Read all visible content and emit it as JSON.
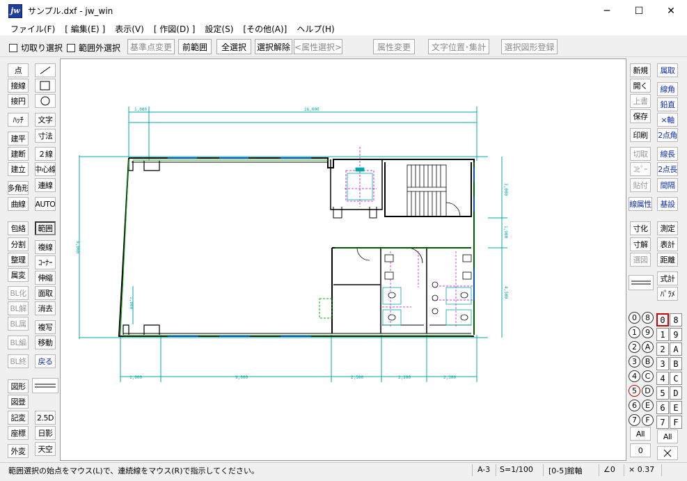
{
  "window": {
    "app_icon_text": "jw",
    "title": "サンプル.dxf - jw_win",
    "minimize": "─",
    "maximize": "☐",
    "close": "✕"
  },
  "menu": [
    "ファイル(F)",
    "[ 編集(E) ]",
    "表示(V)",
    "[ 作図(D) ]",
    "設定(S)",
    "[その他(A)]",
    "ヘルプ(H)"
  ],
  "toolbar": {
    "checkbox_cut_select": "切取り選択",
    "checkbox_outside_select": "範囲外選択",
    "base_point_change": "基準点変更",
    "prev_range": "前範囲",
    "select_all": "全選択",
    "deselect": "選択解除",
    "attr_select": "<属性選択>",
    "attr_change": "属性変更",
    "text_position_total": "文字位置･集計",
    "register_selected_figure": "選択図形登録"
  },
  "left_tools": {
    "point": "点",
    "line_icon": "line-icon",
    "tangent": "接線",
    "rect_icon": "rectangle-icon",
    "tangent_circle": "接円",
    "circle_icon": "circle-icon",
    "hatch": "ﾊｯﾁ",
    "text": "文字",
    "building_plan": "建平",
    "dimension": "寸法",
    "building_section": "建断",
    "double_line": "２線",
    "building_elevation": "建立",
    "center_line": "中心線",
    "polygon": "多角形",
    "continuous_line": "連線",
    "curve": "曲線",
    "auto": "AUTO",
    "envelope": "包絡",
    "range": "範囲",
    "divide": "分割",
    "copy_line": "複線",
    "arrange": "整理",
    "corner": "ｺｰﾅｰ",
    "attr_change": "属変",
    "stretch": "伸縮",
    "bl_make": "BL化",
    "area_fill": "面取",
    "bl_dissolve": "BL解",
    "erase": "消去",
    "bl_attr": "BL属",
    "copy": "複写",
    "bl_edit": "BL編",
    "move": "移動",
    "bl_end": "BL終",
    "back": "戻る",
    "figure": "図形",
    "figure_register": "図登",
    "symbol_change": "記変",
    "view_2_5d": "2.5D",
    "coordinate": "座標",
    "sun_shadow": "日影",
    "external_change": "外変",
    "sky": "天空"
  },
  "right_tools": {
    "new": "新規",
    "attr_get": "属取",
    "open": "開く",
    "line_angle": "線角",
    "overwrite": "上書",
    "vertical": "鉛直",
    "save": "保存",
    "x_axis": "×軸",
    "print": "印刷",
    "two_point_angle": "2点角",
    "cut": "切取",
    "line_length": "線長",
    "copy": "ｺﾋﾟｰ",
    "two_point_length": "2点長",
    "paste": "貼付",
    "spacing": "間隔",
    "line_attr": "線属性",
    "base_set": "基設",
    "dim_make": "寸化",
    "measure": "測定",
    "dim_release": "寸解",
    "table_calc": "表計",
    "select_figure": "選図",
    "distance": "距離",
    "formula": "式計",
    "parametric": "ﾊﾟﾗﾒ"
  },
  "layers": {
    "group_circles": [
      "0",
      "8",
      "1",
      "9",
      "2",
      "A",
      "3",
      "B",
      "4",
      "C",
      "5",
      "D",
      "6",
      "E",
      "7",
      "F"
    ],
    "layer_buttons": [
      "0",
      "8",
      "1",
      "9",
      "2",
      "A",
      "3",
      "B",
      "4",
      "C",
      "5",
      "D",
      "6",
      "E",
      "7",
      "F"
    ],
    "all_group": "All",
    "group_zero": "0",
    "all_layer": "All",
    "x_icon": "close-x-icon"
  },
  "drawing": {
    "top_dims": [
      "1,000",
      "16,000"
    ],
    "right_dims": [
      "3,000",
      "1,900",
      "4,500"
    ],
    "left_dims": [
      "9,000",
      "1,800"
    ],
    "bottom_dims": [
      "1,900",
      "9,000",
      "2,500",
      "2,200",
      "2,300"
    ]
  },
  "statusbar": {
    "message": "範囲選択の始点をマウス(L)で、連続線をマウス(R)で指示してください。",
    "paper": "A-3",
    "scale": "S=1/100",
    "layer": "[0-5]館軸",
    "angle": "∠0",
    "line_size": "× 0.37"
  },
  "colors": {
    "dimension": "#00a8a8",
    "wall": "#000000",
    "grid": "#00b000",
    "magenta": "#c000c0",
    "blue_text": "#1030b0"
  }
}
